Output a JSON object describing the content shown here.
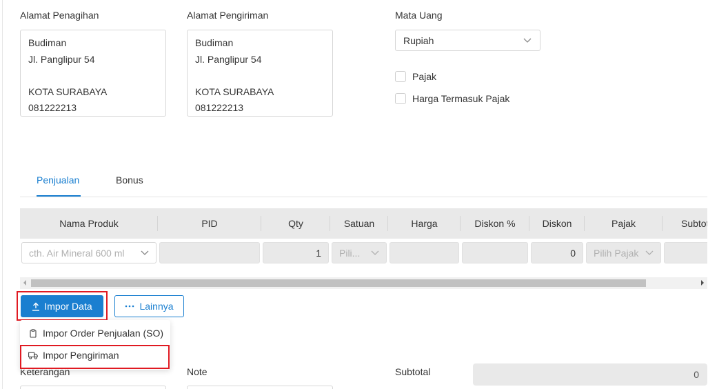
{
  "billing": {
    "label": "Alamat Penagihan",
    "lines": [
      "Budiman",
      "Jl. Panglipur 54",
      "",
      "KOTA SURABAYA",
      "081222213"
    ]
  },
  "shipping": {
    "label": "Alamat Pengiriman",
    "lines": [
      "Budiman",
      "Jl. Panglipur 54",
      "",
      "KOTA SURABAYA",
      "081222213"
    ]
  },
  "currency": {
    "label": "Mata Uang",
    "value": "Rupiah"
  },
  "checkboxes": {
    "tax": "Pajak",
    "price_incl_tax": "Harga Termasuk Pajak"
  },
  "tabs": [
    {
      "label": "Penjualan",
      "active": true
    },
    {
      "label": "Bonus",
      "active": false
    }
  ],
  "table": {
    "columns": [
      "Nama Produk",
      "PID",
      "Qty",
      "Satuan",
      "Harga",
      "Diskon %",
      "Diskon",
      "Pajak",
      "Subtotal"
    ],
    "row": {
      "product_placeholder": "cth. Air Mineral 600 ml",
      "qty": "1",
      "unit_placeholder": "Pili...",
      "discount": "0",
      "tax_placeholder": "Pilih Pajak"
    }
  },
  "buttons": {
    "import": "Impor Data",
    "more": "Lainnya"
  },
  "import_menu": [
    "Impor Order Penjualan (SO)",
    "Impor Pengiriman"
  ],
  "bottom": {
    "notes_label": "Keterangan",
    "note_label": "Note",
    "subtotal_label": "Subtotal",
    "subtotal_value": "0"
  },
  "colors": {
    "accent": "#1a7fd0",
    "highlight": "#e01a22"
  }
}
